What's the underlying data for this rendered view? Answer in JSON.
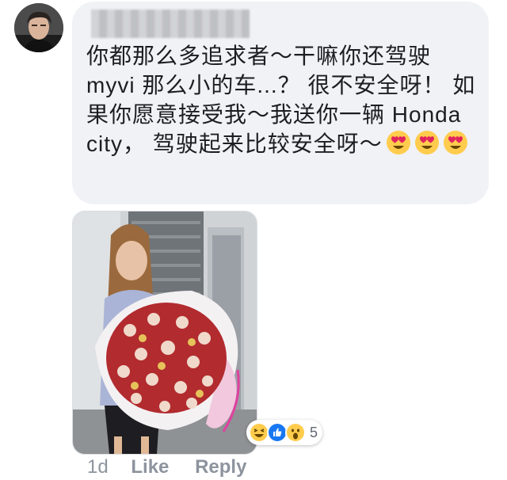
{
  "comment": {
    "author_name": "",
    "text": "你都那么多追求者～干嘛你还驾驶 myvi 那么小的车...？ 很不安全呀！ 如果你愿意接受我～我送你一辆 Honda city， 驾驶起来比较安全呀～",
    "trailing_emoji": [
      "heart-eyes-emoji",
      "heart-eyes-emoji",
      "heart-eyes-emoji"
    ],
    "bubble_color": "#f1f2f6",
    "text_color": "#1c1e21"
  },
  "attachment": {
    "image": "photo-woman-holding-rose-bouquet"
  },
  "reactions": {
    "icons": [
      "haha-reaction-icon",
      "like-reaction-icon",
      "wow-reaction-icon"
    ],
    "count": "5",
    "like_color": "#1877f2"
  },
  "actions": {
    "timestamp": "1d",
    "like_label": "Like",
    "reply_label": "Reply",
    "meta_color": "#8d949e"
  }
}
